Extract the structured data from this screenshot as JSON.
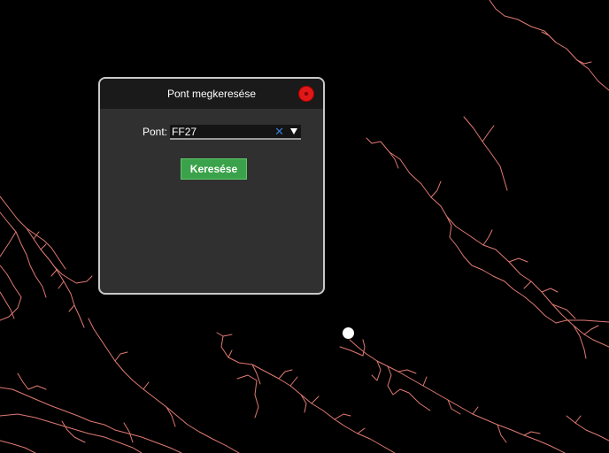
{
  "map": {
    "line_color": "#e07a72",
    "background_color": "#000000"
  },
  "marker": {
    "icon": "location-dot",
    "color": "#ffffff"
  },
  "dialog": {
    "title": "Pont megkeresése",
    "close_icon": "close-icon",
    "close_color": "#e01818",
    "point_label": "Pont:",
    "point_value": "FF27",
    "clear_symbol": "✕",
    "clear_color": "#3a7bd5",
    "search_label": "Keresése",
    "search_color": "#3aa24a"
  }
}
